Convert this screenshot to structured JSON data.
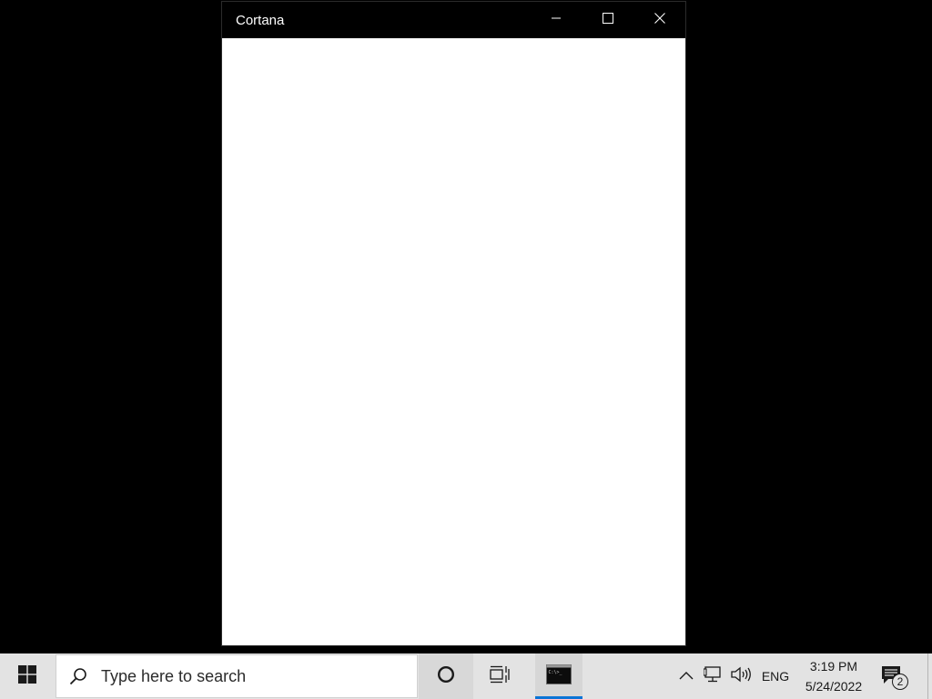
{
  "window": {
    "title": "Cortana",
    "controls": {
      "minimize_icon": "minimize-icon",
      "maximize_icon": "maximize-icon",
      "close_icon": "close-icon"
    }
  },
  "taskbar": {
    "start_icon": "windows-logo-icon",
    "search": {
      "placeholder": "Type here to search",
      "icon": "search-icon"
    },
    "cortana_icon": "cortana-circle-icon",
    "taskview_icon": "task-view-icon",
    "pinned": [
      {
        "name": "command-prompt",
        "icon": "command-prompt-icon",
        "active": true
      }
    ],
    "tray": {
      "chevron_icon": "chevron-up-icon",
      "network_icon": "network-icon",
      "volume_icon": "volume-icon",
      "language": "ENG"
    },
    "clock": {
      "time": "3:19 PM",
      "date": "5/24/2022"
    },
    "notifications": {
      "icon": "notifications-icon",
      "count": "2"
    }
  },
  "colors": {
    "desktop": "#000000",
    "titlebar": "#000000",
    "content": "#ffffff",
    "taskbar": "#e3e3e3",
    "accent": "#0a74d6"
  }
}
